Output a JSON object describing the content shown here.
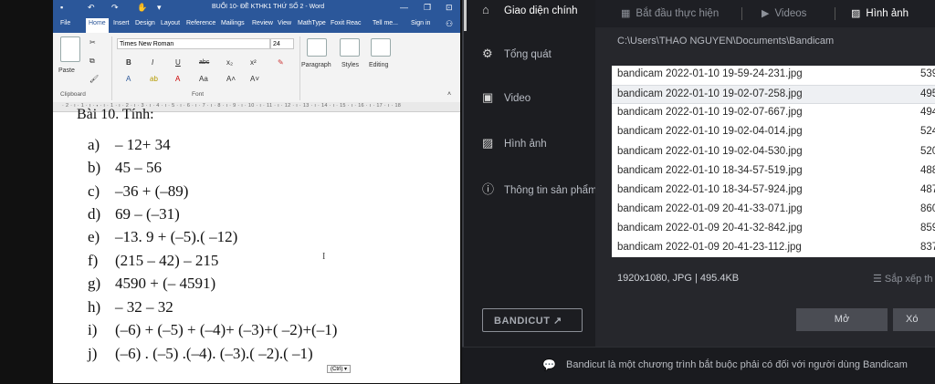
{
  "word": {
    "title": "BUỔI 10- ĐỀ KTHK1 THỨ SỐ 2 - Word",
    "window_buttons": {
      "minimize": "—",
      "restore": "❐",
      "close": "✕"
    },
    "tabs": [
      "File",
      "Home",
      "Insert",
      "Design",
      "Layout",
      "Reference",
      "Mailings",
      "Review",
      "View",
      "MathType",
      "Foxit Reac",
      "Tell me...",
      "Sign in"
    ],
    "ribbon": {
      "font_name": "Times New Roman",
      "font_size": "24",
      "paste_label": "Paste",
      "clipboard_label": "Clipboard",
      "font_group_label": "Font",
      "paragraph_label": "Paragraph",
      "styles_label": "Styles",
      "editing_label": "Editing",
      "bold": "B",
      "italic": "I",
      "underline": "U",
      "strike": "abc",
      "subscript": "x₂",
      "superscript": "x²"
    },
    "ruler": "· 2 · ı · 1 · ı · 🞄 · ı · 1 · ı · 2 · ı · 3 · ı · 4 · ı · 5 · ı · 6 · ı · 7 · ı · 8 · ı · 9 · ı · 10 · ı · 11 · ı · 12 · ı · 13 · ı · 14 · ı · 15 · ı · 16 · ı · 17 · ı · 18",
    "doc": {
      "heading": "Bài 10. Tính:",
      "items": [
        {
          "label": "a)",
          "expr": "– 12+ 34"
        },
        {
          "label": "b)",
          "expr": "45 – 56"
        },
        {
          "label": "c)",
          "expr": "–36 + (–89)"
        },
        {
          "label": "d)",
          "expr": "69 – (–31)"
        },
        {
          "label": "e)",
          "expr": "–13. 9 + (–5).( –12)"
        },
        {
          "label": "f)",
          "expr": "(215 – 42) – 215"
        },
        {
          "label": "g)",
          "expr": "4590 + (– 4591)"
        },
        {
          "label": "h)",
          "expr": "– 32 – 32"
        },
        {
          "label": "i)",
          "expr": "(–6) + (–5) + (–4)+ (–3)+( –2)+(–1)"
        },
        {
          "label": "j)",
          "expr": "(–6) . (–5) .(–4). (–3).( –2).( –1)"
        }
      ],
      "ctrl_tag": "(Ctrl) ▾"
    }
  },
  "bandicam": {
    "nav": [
      {
        "icon": "home-icon",
        "glyph": "⌂",
        "label": "Giao diện chính",
        "active": true
      },
      {
        "icon": "gear-icon",
        "glyph": "⚙",
        "label": "Tổng quát",
        "active": false
      },
      {
        "icon": "video-icon",
        "glyph": "▣",
        "label": "Video",
        "active": false
      },
      {
        "icon": "image-icon",
        "glyph": "▨",
        "label": "Hình ảnh",
        "active": false
      },
      {
        "icon": "info-icon",
        "glyph": "ⓘ",
        "label": "Thông tin sản phẩm",
        "active": false
      }
    ],
    "bandicut_label": "BANDICUT ↗",
    "tabs": [
      {
        "label": "Bắt đầu thực hiện",
        "glyph": "▦",
        "active": false
      },
      {
        "label": "Videos",
        "glyph": "▶",
        "active": false
      },
      {
        "label": "Hình ảnh",
        "glyph": "▨",
        "active": true
      }
    ],
    "path": "C:\\Users\\THAO NGUYEN\\Documents\\Bandicam",
    "files": [
      {
        "name": "bandicam 2022-01-10 19-59-24-231.jpg",
        "size": "539"
      },
      {
        "name": "bandicam 2022-01-10 19-02-07-258.jpg",
        "size": "495",
        "selected": true
      },
      {
        "name": "bandicam 2022-01-10 19-02-07-667.jpg",
        "size": "494"
      },
      {
        "name": "bandicam 2022-01-10 19-02-04-014.jpg",
        "size": "524"
      },
      {
        "name": "bandicam 2022-01-10 19-02-04-530.jpg",
        "size": "520"
      },
      {
        "name": "bandicam 2022-01-10 18-34-57-519.jpg",
        "size": "488"
      },
      {
        "name": "bandicam 2022-01-10 18-34-57-924.jpg",
        "size": "487"
      },
      {
        "name": "bandicam 2022-01-09 20-41-33-071.jpg",
        "size": "860"
      },
      {
        "name": "bandicam 2022-01-09 20-41-32-842.jpg",
        "size": "859"
      },
      {
        "name": "bandicam 2022-01-09 20-41-23-112.jpg",
        "size": "837"
      }
    ],
    "file_info": "1920x1080, JPG | 495.4KB",
    "sort_label": "☰ Sắp xếp th",
    "open_button": "Mở",
    "x_button": "Xó",
    "footer_text": "Bandicut là một chương trình bắt buộc phải có đối với người dùng Bandicam",
    "footer_icon": "💬"
  }
}
